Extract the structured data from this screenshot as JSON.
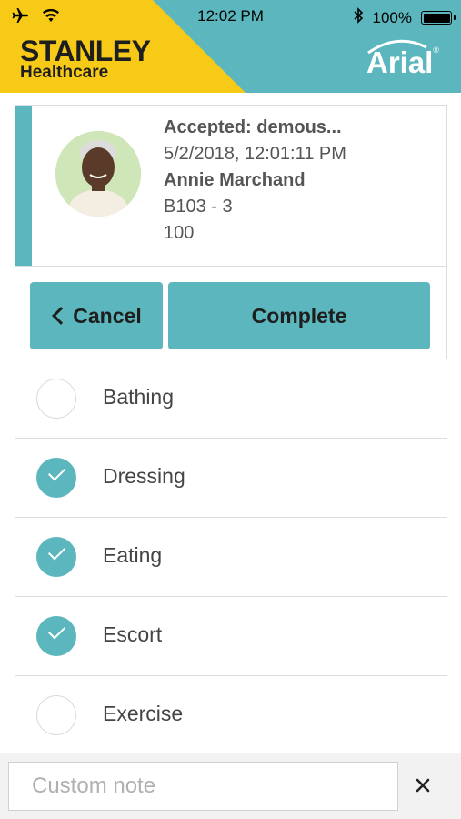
{
  "status_bar": {
    "time": "12:02 PM",
    "battery": "100%"
  },
  "brand": {
    "company": "STANLEY",
    "division": "Healthcare",
    "product": "Arial",
    "trademark": "®"
  },
  "alert": {
    "title": "Accepted: demous...",
    "datetime": "5/2/2018, 12:01:11 PM",
    "resident": "Annie Marchand",
    "room": "B103 - 3",
    "code": "100"
  },
  "actions": {
    "cancel_label": "Cancel",
    "complete_label": "Complete"
  },
  "tasks": [
    {
      "label": "Bathing",
      "checked": false
    },
    {
      "label": "Dressing",
      "checked": true
    },
    {
      "label": "Eating",
      "checked": true
    },
    {
      "label": "Escort",
      "checked": true
    },
    {
      "label": "Exercise",
      "checked": false
    }
  ],
  "note": {
    "placeholder": "Custom note",
    "value": ""
  },
  "colors": {
    "accent": "#5bb7bd",
    "brand_yellow": "#f7ca18"
  }
}
